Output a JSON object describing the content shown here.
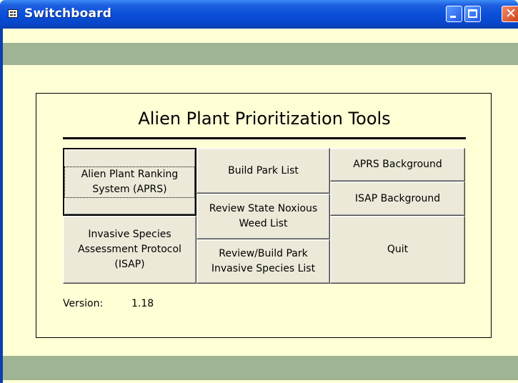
{
  "window": {
    "title": "Switchboard",
    "icon": "form-icon",
    "controls": [
      "minimize",
      "maximize",
      "close"
    ]
  },
  "panel": {
    "heading": "Alien Plant Prioritization Tools"
  },
  "buttons": {
    "aprs": "Alien Plant Ranking System (APRS)",
    "isap": "Invasive Species Assessment Protocol (ISAP)",
    "build_park_list": "Build Park List",
    "review_state_noxious": "Review State Noxious Weed List",
    "review_build_park_invasive": "Review/Build Park Invasive Species List",
    "aprs_background": "APRS Background",
    "isap_background": "ISAP Background",
    "quit": "Quit"
  },
  "version": {
    "label": "Version:",
    "value": "1.18"
  },
  "colors": {
    "form_background": "#ffffd6",
    "band": "#9eb492",
    "button_face": "#ece9d8",
    "titlebar": "#0a4fd8"
  }
}
